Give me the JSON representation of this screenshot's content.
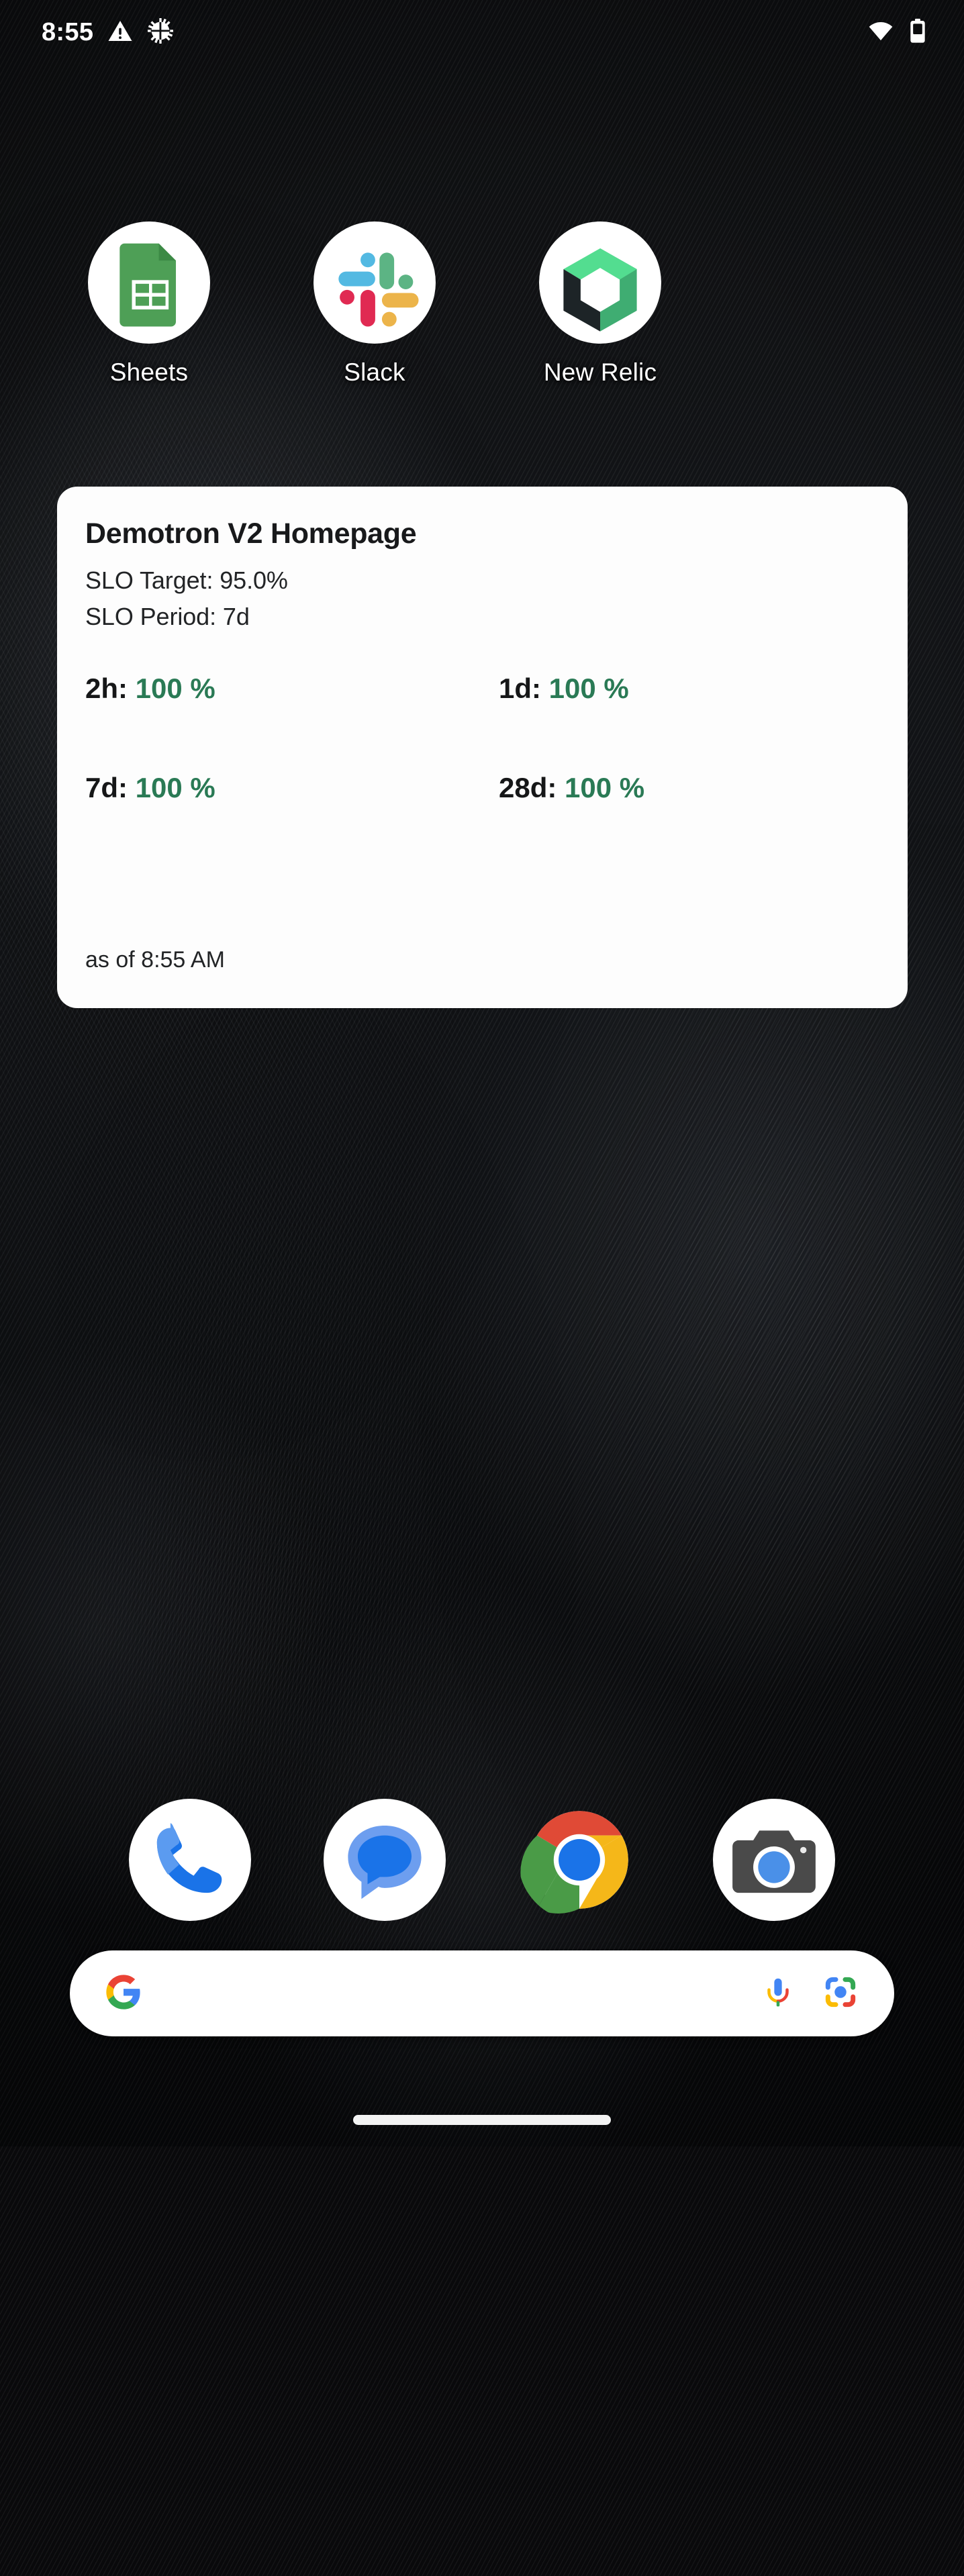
{
  "status_bar": {
    "time": "8:55",
    "left_icons": [
      {
        "name": "warning-triangle-icon",
        "glyph": "warning"
      },
      {
        "name": "gear-icon",
        "glyph": "gear"
      }
    ],
    "right_icons": [
      {
        "name": "wifi-icon",
        "glyph": "wifi"
      },
      {
        "name": "battery-icon",
        "glyph": "battery"
      }
    ]
  },
  "home_screen": {
    "apps": [
      {
        "label": "Sheets",
        "icon": "google-sheets-icon"
      },
      {
        "label": "Slack",
        "icon": "slack-icon"
      },
      {
        "label": "New Relic",
        "icon": "new-relic-icon"
      }
    ]
  },
  "widget": {
    "title": "Demotron V2 Homepage",
    "slo_target_line": "SLO Target: 95.0%",
    "slo_period_line": "SLO Period: 7d",
    "slo_entries": [
      {
        "label": "2h:",
        "value": "100 %"
      },
      {
        "label": "1d:",
        "value": "100 %"
      },
      {
        "label": "7d:",
        "value": "100 %"
      },
      {
        "label": "28d:",
        "value": "100 %"
      }
    ],
    "as_of": "as of 8:55 AM",
    "value_color": "#2a7a55",
    "card_color": "#fdfdfd"
  },
  "dock": {
    "apps": [
      {
        "name": "phone-app",
        "icon": "phone-icon"
      },
      {
        "name": "messages-app",
        "icon": "messages-icon"
      },
      {
        "name": "chrome-app",
        "icon": "chrome-icon"
      },
      {
        "name": "camera-app",
        "icon": "camera-icon"
      }
    ]
  },
  "search": {
    "placeholder": "",
    "value": "",
    "logo": "google-g-icon",
    "mic": "microphone-icon",
    "lens": "google-lens-icon"
  },
  "navigation": {
    "pill": "gesture-nav-pill"
  }
}
